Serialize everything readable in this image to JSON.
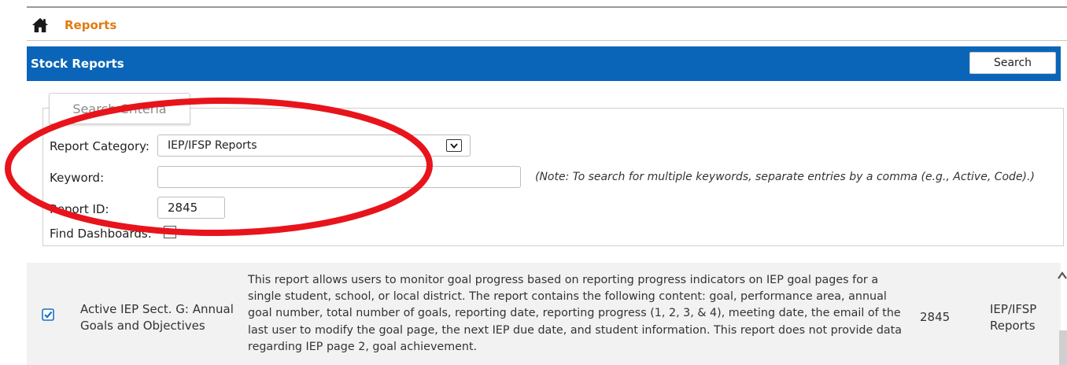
{
  "breadcrumb": {
    "icon": "home-icon",
    "link": "Reports"
  },
  "panel": {
    "title": "Stock Reports",
    "search_label": "Search"
  },
  "criteria": {
    "tab_label": "Search Criteria",
    "category_label": "Report Category:",
    "category_value": "IEP/IFSP Reports",
    "keyword_label": "Keyword:",
    "keyword_value": "",
    "keyword_note": "(Note: To search for multiple keywords, separate entries by a comma (e.g., Active, Code).)",
    "report_id_label": "Report ID:",
    "report_id_value": "2845",
    "dashboards_label": "Find Dashboards:",
    "dashboards_checked": false
  },
  "results": [
    {
      "selected": true,
      "name": "Active IEP Sect. G: Annual Goals and Objectives",
      "description": "This report allows users to monitor goal progress based on reporting progress indicators on IEP goal pages for a single student, school, or local district. The report contains the following content: goal, performance area, annual goal number, total number of goals, reporting date, reporting progress (1, 2, 3, & 4), meeting date, the email of the last user to modify the goal page, the next IEP due date, and student information. This report does not provide data regarding IEP page 2, goal achievement.",
      "id": "2845",
      "category": "IEP/IFSP Reports"
    }
  ],
  "colors": {
    "header_blue": "#0a65b8",
    "link_orange": "#e07b12",
    "annotation_red": "#e8141c",
    "check_blue": "#1d6fc4"
  }
}
